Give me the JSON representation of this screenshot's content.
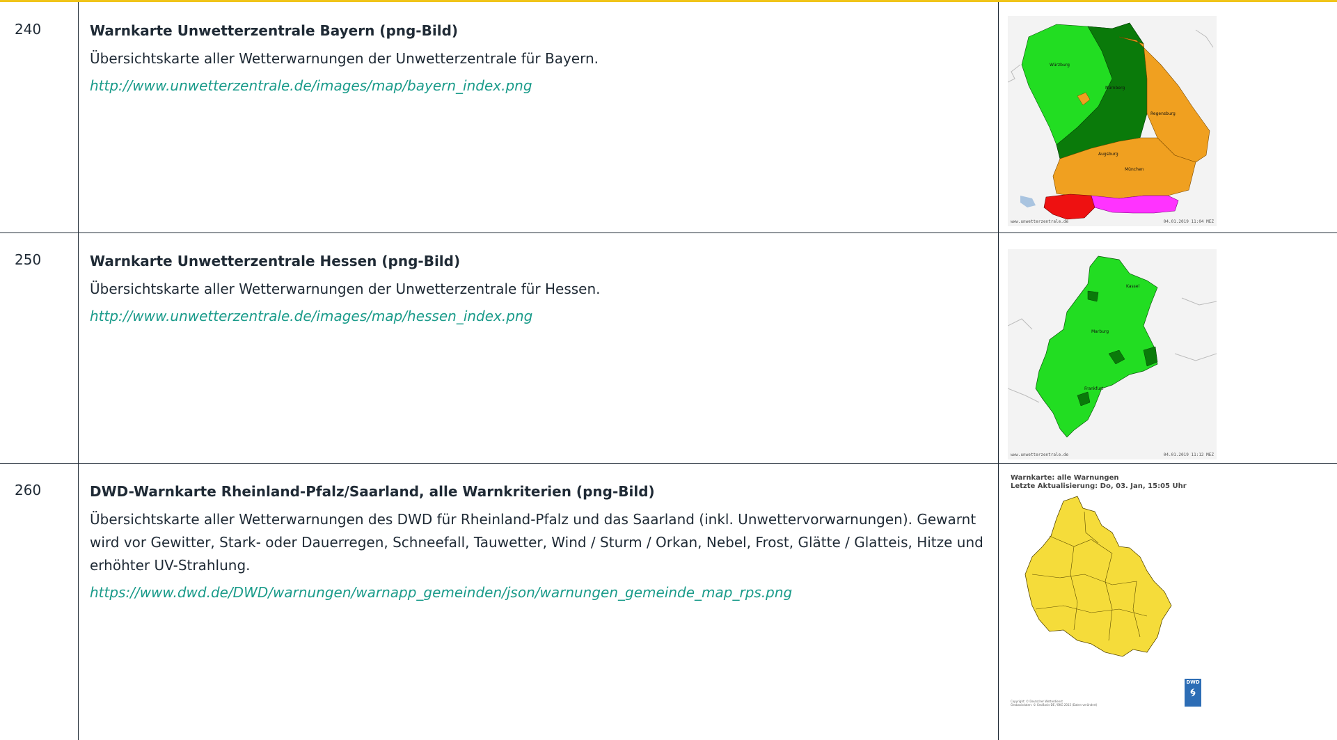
{
  "rows": [
    {
      "id": "240",
      "title": "Warnkarte Unwetterzentrale Bayern (png-Bild)",
      "description": "Übersichtskarte aller Wetterwarnungen der Unwetterzentrale für Bayern.",
      "link": "http://www.unwetterzentrale.de/images/map/bayern_index.png",
      "image": {
        "footer_left": "www.unwetterzentrale.de",
        "footer_right": "04.01.2019 11:04 MEZ",
        "cities": [
          "Würzburg",
          "Nürnberg",
          "Regensburg",
          "Augsburg",
          "München"
        ]
      }
    },
    {
      "id": "250",
      "title": "Warnkarte Unwetterzentrale Hessen (png-Bild)",
      "description": "Übersichtskarte aller Wetterwarnungen der Unwetterzentrale für Hessen.",
      "link": "http://www.unwetterzentrale.de/images/map/hessen_index.png",
      "image": {
        "footer_left": "www.unwetterzentrale.de",
        "footer_right": "04.01.2019 11:12 MEZ",
        "cities": [
          "Kassel",
          "Marburg",
          "Frankfurt"
        ]
      }
    },
    {
      "id": "260",
      "title": "DWD-Warnkarte Rheinland-Pfalz/Saarland, alle Warnkriterien (png-Bild)",
      "description": "Übersichtskarte aller Wetterwarnungen des DWD für Rheinland-Pfalz und das Saarland (inkl. Unwettervorwarnungen). Gewarnt wird vor Gewitter, Stark- oder Dauerregen, Schneefall, Tauwetter, Wind / Sturm / Orkan, Nebel, Frost, Glätte / Glatteis, Hitze und erhöhter UV-Strahlung.",
      "link": "https://www.dwd.de/DWD/warnungen/warnapp_gemeinden/json/warnungen_gemeinde_map_rps.png",
      "image": {
        "header_line1": "Warnkarte: alle Warnungen",
        "header_line2": "Letzte Aktualisierung: Do, 03. Jan, 15:05 Uhr",
        "logo_text": "DWD",
        "copyright_line1": "Copyright: © Deutscher Wetterdienst",
        "copyright_line2": "Geobasisdaten: © GeoBasis-DE / BKG 2015 (Daten verändert)"
      }
    }
  ],
  "colors": {
    "accent_top": "#f0c419",
    "link": "#1a9b8a",
    "text": "#1f2a35",
    "warn_green": "#22dd22",
    "warn_darkgreen": "#0a7a0a",
    "warn_orange": "#f0a020",
    "warn_red": "#ee1111",
    "warn_magenta": "#ff33ff",
    "dwd_yellow": "#f5dc3a"
  }
}
